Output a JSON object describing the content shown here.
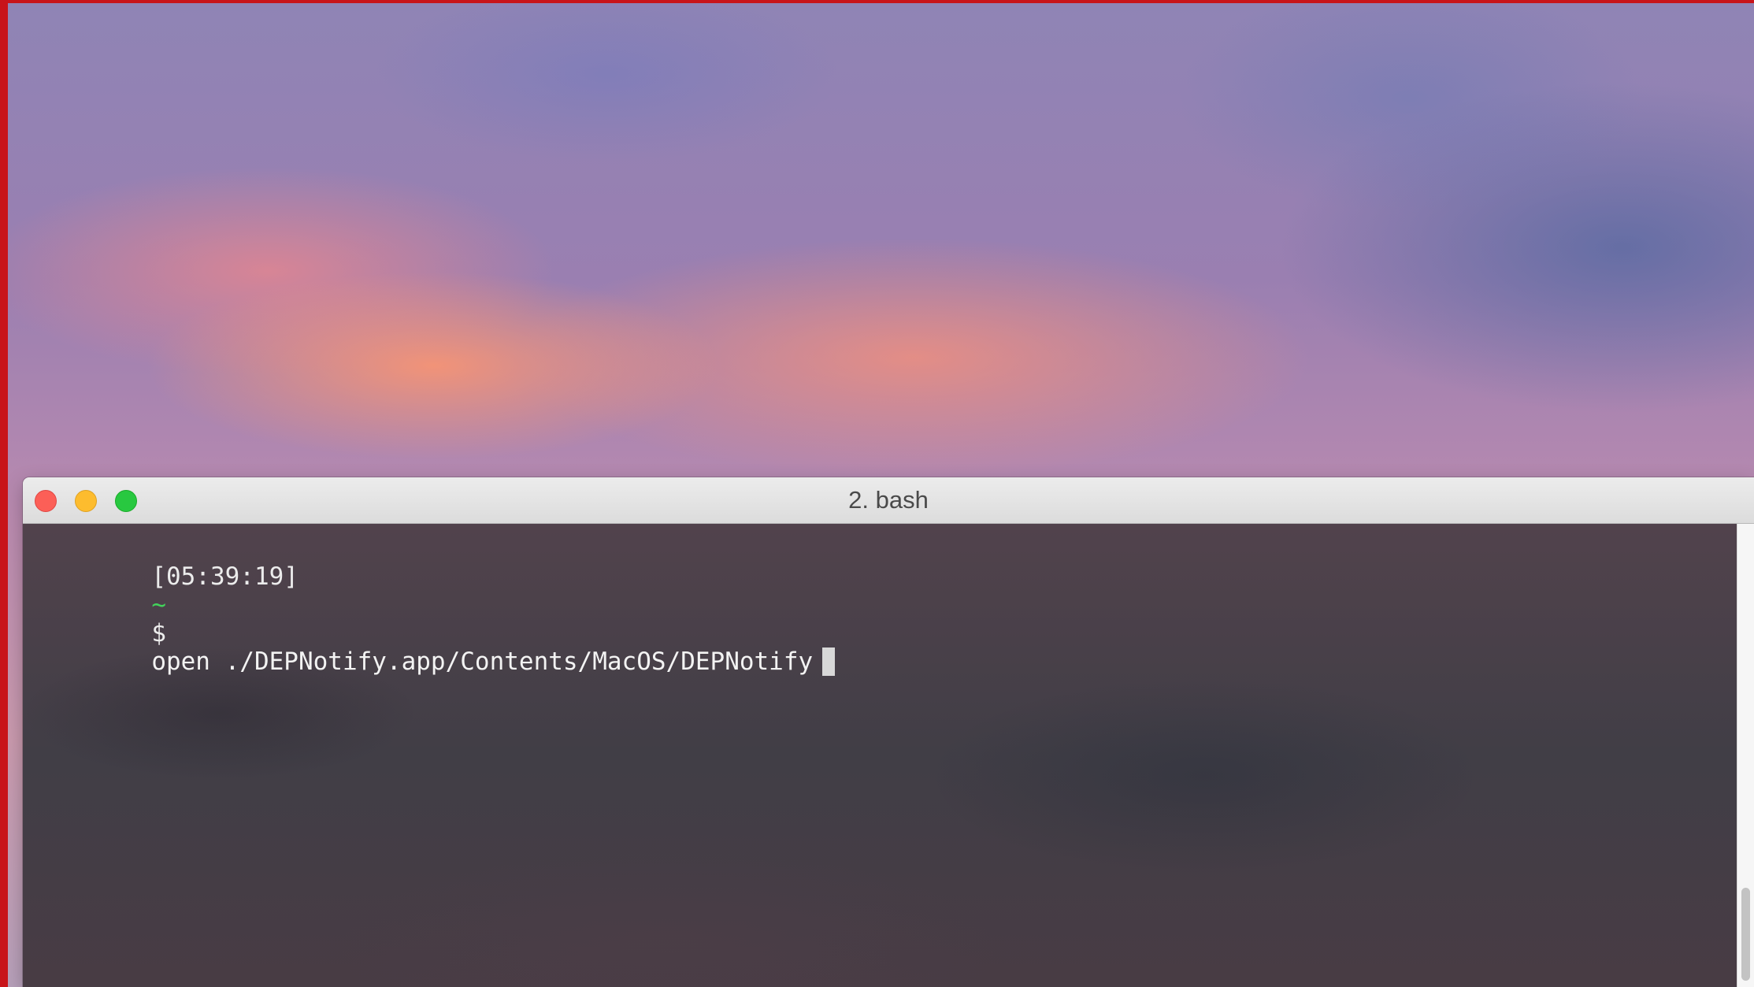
{
  "window": {
    "title": "2. bash"
  },
  "terminal": {
    "prompt": {
      "timestamp": "[05:39:19]",
      "directory": "~",
      "symbol": "$",
      "command": "open ./DEPNotify.app/Contents/MacOS/DEPNotify"
    }
  },
  "colors": {
    "frame": "#c8141a",
    "close": "#fc5f57",
    "minimize": "#fdbc2e",
    "zoom": "#28c840",
    "prompt_tilde": "#42d35b"
  }
}
